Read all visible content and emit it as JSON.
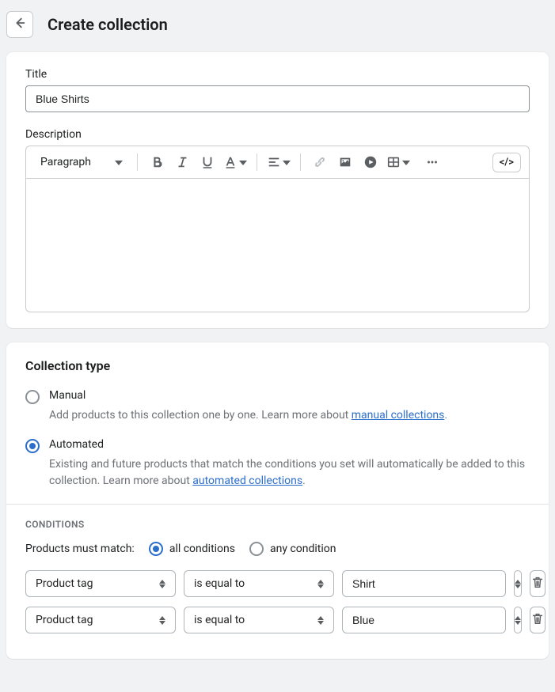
{
  "header": {
    "title": "Create collection"
  },
  "title_section": {
    "label": "Title",
    "value": "Blue Shirts"
  },
  "description": {
    "label": "Description",
    "paragraph_selector": "Paragraph"
  },
  "collection_type": {
    "heading": "Collection type",
    "manual": {
      "label": "Manual",
      "help_prefix": "Add products to this collection one by one. Learn more about ",
      "link": "manual collections",
      "help_suffix": "."
    },
    "automated": {
      "label": "Automated",
      "help_prefix": "Existing and future products that match the conditions you set will automatically be added to this collection. Learn more about ",
      "link": "automated collections",
      "help_suffix": "."
    },
    "selected": "automated"
  },
  "conditions": {
    "heading": "CONDITIONS",
    "match_label": "Products must match:",
    "all_label": "all conditions",
    "any_label": "any condition",
    "match_selected": "all",
    "rows": [
      {
        "field": "Product tag",
        "relation": "is equal to",
        "value": "Shirt"
      },
      {
        "field": "Product tag",
        "relation": "is equal to",
        "value": "Blue"
      }
    ]
  }
}
